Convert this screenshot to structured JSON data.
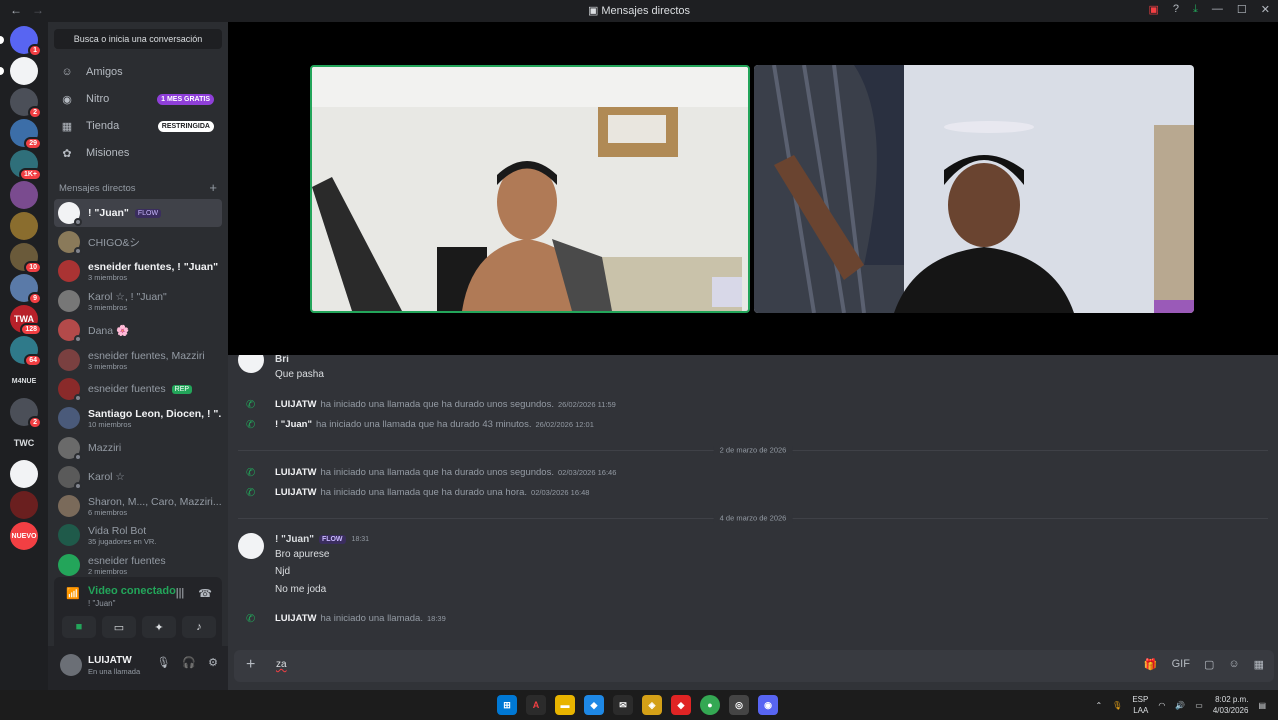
{
  "window": {
    "title": "Mensajes directos"
  },
  "servers": [
    {
      "label": "",
      "badge": "1",
      "color": "#5865f2"
    },
    {
      "label": "",
      "badge": "",
      "color": "#f2f3f5"
    },
    {
      "label": "",
      "badge": "2",
      "color": "#4b4f58"
    },
    {
      "label": "",
      "badge": "29",
      "color": "#3c6ea8"
    },
    {
      "label": "",
      "badge": "1K+",
      "color": "#2f6f7a"
    },
    {
      "label": "",
      "badge": "",
      "color": "#7a4b8f"
    },
    {
      "label": "",
      "badge": "",
      "color": "#8a6d2e"
    },
    {
      "label": "",
      "badge": "10",
      "color": "#6a5a3a"
    },
    {
      "label": "",
      "badge": "9",
      "color": "#5a7aa8"
    },
    {
      "label": "TWA",
      "badge": "128",
      "color": "#b8212a"
    },
    {
      "label": "",
      "badge": "64",
      "color": "#2f7a8a"
    },
    {
      "label": "M4NUE",
      "badge": "",
      "color": "#1e1f22"
    },
    {
      "label": "",
      "badge": "2",
      "color": "#4b4f58"
    },
    {
      "label": "TWC",
      "badge": "",
      "color": "#1e1f22"
    },
    {
      "label": "",
      "badge": "",
      "color": "#f2f3f5"
    },
    {
      "label": "",
      "badge": "",
      "color": "#6a1f1f"
    },
    {
      "label": "NUEVO",
      "badge": "",
      "color": "#f23f43"
    }
  ],
  "sidebar": {
    "search": "Busca o inicia una conversación",
    "nav": [
      {
        "label": "Amigos",
        "icon": "friends-icon",
        "tag": ""
      },
      {
        "label": "Nitro",
        "icon": "nitro-icon",
        "tag": "1 MES GRATIS"
      },
      {
        "label": "Tienda",
        "icon": "shop-icon",
        "tag": "RESTRINGIDA"
      },
      {
        "label": "Misiones",
        "icon": "quests-icon",
        "tag": ""
      }
    ],
    "dm_header": "Mensajes directos",
    "dms": [
      {
        "name": "! \"Juan\"",
        "sub": "",
        "bold": true,
        "badge": "FLOW",
        "color": "#f2f3f5"
      },
      {
        "name": "CHIGO&シ",
        "sub": "",
        "bold": false,
        "badge": "",
        "color": "#8a7a5a"
      },
      {
        "name": "esneider fuentes, ! \"Juan\"",
        "sub": "3 miembros",
        "bold": true,
        "badge": "",
        "color": "#a33"
      },
      {
        "name": "Karol ☆, ! \"Juan\"",
        "sub": "3 miembros",
        "bold": false,
        "badge": "",
        "color": "#777"
      },
      {
        "name": "Dana 🌸",
        "sub": "",
        "bold": false,
        "badge": "",
        "color": "#b34a4a"
      },
      {
        "name": "esneider fuentes, Mazziri",
        "sub": "3 miembros",
        "bold": false,
        "badge": "",
        "color": "#7a4040"
      },
      {
        "name": "esneider fuentes",
        "sub": "",
        "bold": false,
        "badge": "REP",
        "color": "#8a2a2a"
      },
      {
        "name": "Santiago Leon, Diocen, ! \"...",
        "sub": "10 miembros",
        "bold": true,
        "badge": "",
        "color": "#4a5a7a"
      },
      {
        "name": "Mazziri",
        "sub": "",
        "bold": false,
        "badge": "",
        "color": "#6a6a6a"
      },
      {
        "name": "Karol ☆",
        "sub": "",
        "bold": false,
        "badge": "",
        "color": "#5a5a5a"
      },
      {
        "name": "Sharon, M..., Caro, Mazziri...",
        "sub": "6 miembros",
        "bold": false,
        "badge": "",
        "color": "#7a6a5a"
      },
      {
        "name": "Vida Rol Bot",
        "sub": "35 jugadores en VR.",
        "bold": false,
        "badge": "",
        "color": "#1f5a4a"
      },
      {
        "name": "esneider fuentes",
        "sub": "2 miembros",
        "bold": false,
        "badge": "",
        "color": "#23a55a"
      }
    ],
    "voice": {
      "status": "Video conectado",
      "channel": "! \"Juan\""
    },
    "user": {
      "name": "LUIJATW",
      "status": "En una llamada"
    }
  },
  "chat": {
    "top_partial": {
      "name": "Bri",
      "text": "Que pasha"
    },
    "calls1": [
      {
        "user": "LUIJATW",
        "text": "ha iniciado una llamada que ha durado unos segundos.",
        "time": "26/02/2026 11:59"
      },
      {
        "user": "! \"Juan\"",
        "text": "ha iniciado una llamada que ha durado 43 minutos.",
        "time": "26/02/2026 12:01"
      }
    ],
    "date1": "2 de marzo de 2026",
    "calls2": [
      {
        "user": "LUIJATW",
        "text": "ha iniciado una llamada que ha durado unos segundos.",
        "time": "02/03/2026 16:46"
      },
      {
        "user": "LUIJATW",
        "text": "ha iniciado una llamada que ha durado una hora.",
        "time": "02/03/2026 16:48"
      }
    ],
    "date2": "4 de marzo de 2026",
    "message": {
      "author": "! \"Juan\"",
      "badge": "FLOW",
      "time": "18:31",
      "lines": [
        "Bro apurese",
        "Njd",
        "No me joda"
      ]
    },
    "last_call": {
      "user": "LUIJATW",
      "text": "ha iniciado una llamada.",
      "time": "18:39"
    },
    "composer_text": "za"
  },
  "taskbar": {
    "lang1": "ESP",
    "lang2": "LAA",
    "time": "8:02 p.m.",
    "date": "4/03/2026"
  }
}
